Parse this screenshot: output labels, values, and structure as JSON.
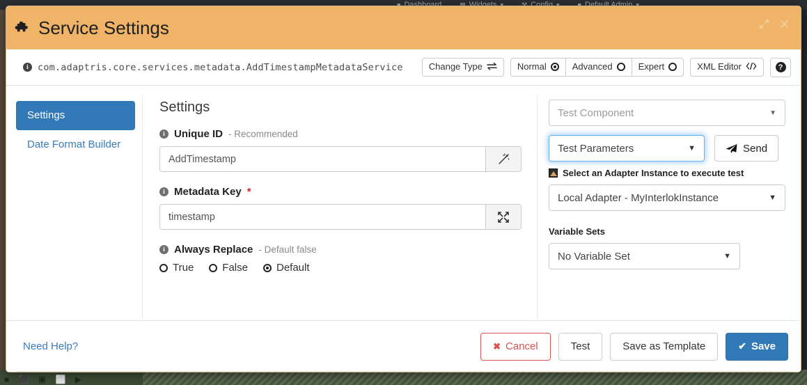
{
  "background": {
    "navbar_items": [
      {
        "icon": "home-icon",
        "label": "Dashboard"
      },
      {
        "icon": "widgets-icon",
        "label": "Widgets"
      },
      {
        "icon": "wrench-icon",
        "label": "Config"
      },
      {
        "icon": "user-icon",
        "label": "Default Admin"
      }
    ],
    "taskbar_glyphs": "■ ⬛ ▣ ⬜ ▶"
  },
  "header": {
    "title": "Service Settings",
    "icon": "puzzle-piece-icon",
    "expand_icon": "expand-icon",
    "close_icon": "close-icon"
  },
  "classname": {
    "info_icon": "info-icon",
    "value": "com.adaptris.core.services.metadata.AddTimestampMetadataService"
  },
  "toolbar": {
    "change_type_label": "Change Type",
    "change_type_icon": "swap-arrows-icon",
    "modes": [
      {
        "label": "Normal",
        "selected": true
      },
      {
        "label": "Advanced",
        "selected": false
      },
      {
        "label": "Expert",
        "selected": false
      }
    ],
    "xml_editor_label": "XML Editor",
    "xml_editor_icon": "code-icon",
    "help_label": "?",
    "help_icon": "question-mark-icon"
  },
  "sidebar": {
    "items": [
      {
        "label": "Settings",
        "active": true
      },
      {
        "label": "Date Format Builder",
        "active": false
      }
    ]
  },
  "center": {
    "title": "Settings",
    "fields": [
      {
        "label": "Unique ID",
        "hint": "- Recommended",
        "required": false,
        "value": "AddTimestamp",
        "placeholder": "",
        "addon_icon": "magic-wand-icon"
      },
      {
        "label": "Metadata Key",
        "hint": "",
        "required": true,
        "value": "timestamp",
        "placeholder": "",
        "addon_icon": "expand-arrows-icon"
      }
    ],
    "radio_group": {
      "label": "Always Replace",
      "hint": "- Default false",
      "options": [
        {
          "label": "True",
          "selected": false
        },
        {
          "label": "False",
          "selected": false
        },
        {
          "label": "Default",
          "selected": true
        }
      ]
    }
  },
  "right": {
    "test_component": {
      "value": "Test Component",
      "is_placeholder": true,
      "caret_icon": "chevron-down-icon"
    },
    "test_parameters": {
      "value": "Test Parameters",
      "focused": true,
      "caret_icon": "chevron-down-icon"
    },
    "send_button": {
      "label": "Send",
      "icon": "paper-plane-icon"
    },
    "adapter_section": {
      "icon": "adapter-instance-icon",
      "label": "Select an Adapter Instance to execute test",
      "selected": "Local Adapter - MyInterlokInstance",
      "caret_icon": "chevron-down-icon"
    },
    "variable_sets": {
      "label": "Variable Sets",
      "selected": "No Variable Set",
      "caret_icon": "chevron-down-icon"
    }
  },
  "footer": {
    "need_help": "Need Help?",
    "cancel": {
      "label": "Cancel",
      "icon": "x-icon"
    },
    "test": {
      "label": "Test"
    },
    "save_as_template": {
      "label": "Save as Template"
    },
    "save": {
      "label": "Save",
      "icon": "check-icon"
    }
  },
  "colors": {
    "header_orange": "#efb468",
    "accent_blue": "#3279b7",
    "link_blue": "#3a7bbd",
    "danger_red": "#d9534f",
    "required_red": "#e02020"
  }
}
